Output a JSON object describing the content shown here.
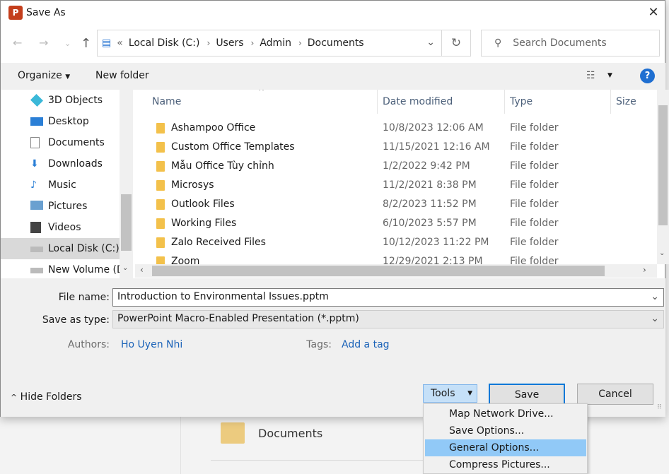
{
  "window": {
    "title": "Save As",
    "app_icon_letter": "P"
  },
  "nav": {
    "breadcrumb": [
      "Local Disk (C:)",
      "Users",
      "Admin",
      "Documents"
    ],
    "search_placeholder": "Search Documents"
  },
  "toolbar": {
    "organize": "Organize",
    "new_folder": "New folder"
  },
  "sidebar": {
    "items": [
      {
        "label": "3D Objects",
        "icon": "3d-objects-icon"
      },
      {
        "label": "Desktop",
        "icon": "desktop-icon"
      },
      {
        "label": "Documents",
        "icon": "documents-icon"
      },
      {
        "label": "Downloads",
        "icon": "downloads-icon"
      },
      {
        "label": "Music",
        "icon": "music-icon"
      },
      {
        "label": "Pictures",
        "icon": "pictures-icon"
      },
      {
        "label": "Videos",
        "icon": "videos-icon"
      },
      {
        "label": "Local Disk (C:)",
        "icon": "drive-icon",
        "selected": true
      },
      {
        "label": "New Volume (D:)",
        "icon": "drive-icon"
      }
    ]
  },
  "columns": [
    "Name",
    "Date modified",
    "Type",
    "Size"
  ],
  "files": [
    {
      "name": "Ashampoo Office",
      "date": "10/8/2023 12:06 AM",
      "type": "File folder"
    },
    {
      "name": "Custom Office Templates",
      "date": "11/15/2021 12:16 AM",
      "type": "File folder"
    },
    {
      "name": "Mẫu Office Tùy chỉnh",
      "date": "1/2/2022 9:42 PM",
      "type": "File folder"
    },
    {
      "name": "Microsys",
      "date": "11/2/2021 8:38 PM",
      "type": "File folder"
    },
    {
      "name": "Outlook Files",
      "date": "8/2/2023 11:52 PM",
      "type": "File folder"
    },
    {
      "name": "Working Files",
      "date": "6/10/2023 5:57 PM",
      "type": "File folder"
    },
    {
      "name": "Zalo Received Files",
      "date": "10/12/2023 11:22 PM",
      "type": "File folder"
    },
    {
      "name": "Zoom",
      "date": "12/29/2021 2:13 PM",
      "type": "File folder"
    }
  ],
  "form": {
    "file_name_label": "File name:",
    "file_name": "Introduction to Environmental Issues.pptm",
    "type_label": "Save as type:",
    "type": "PowerPoint Macro-Enabled Presentation (*.pptm)",
    "authors_label": "Authors:",
    "authors": "Ho Uyen Nhi",
    "tags_label": "Tags:",
    "tags": "Add a tag"
  },
  "footer": {
    "hide_folders": "Hide Folders",
    "tools": "Tools",
    "save": "Save",
    "cancel": "Cancel"
  },
  "tools_menu": [
    "Map Network Drive...",
    "Save Options...",
    "General Options...",
    "Compress Pictures..."
  ],
  "tools_menu_highlighted": "General Options...",
  "background": {
    "folder": "Documents"
  },
  "colors": {
    "accent": "#0078d7",
    "highlight": "#91c9f7",
    "link": "#1a62b8"
  }
}
